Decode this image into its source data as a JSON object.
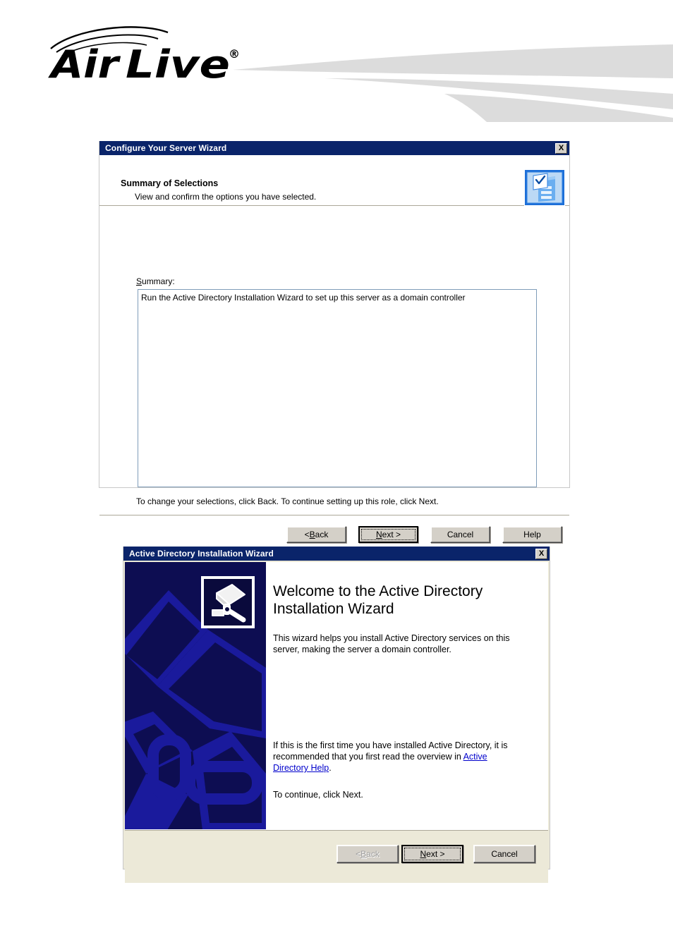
{
  "page": {
    "brand_name": "Air Live",
    "brand_trademark": "®"
  },
  "dialog_configure_server": {
    "title": "Configure Your Server Wizard",
    "close_label": "X",
    "header_title": "Summary of Selections",
    "header_subtitle": "View and confirm the options you have selected.",
    "header_icon": "server-checklist-icon",
    "summary_label": "Summary:",
    "summary_items": [
      "Run the Active Directory Installation Wizard to set up this server as a domain controller"
    ],
    "instruction": "To change your selections, click Back. To continue setting up this role, click Next.",
    "buttons": [
      {
        "label": "< Back",
        "accel": "B",
        "state": "enabled",
        "default": false
      },
      {
        "label": "Next >",
        "accel": "N",
        "state": "enabled",
        "default": true
      },
      {
        "label": "Cancel",
        "accel": "",
        "state": "enabled",
        "default": false
      },
      {
        "label": "Help",
        "accel": "",
        "state": "enabled",
        "default": false
      }
    ]
  },
  "dialog_ad_wizard": {
    "title": "Active Directory Installation Wizard",
    "close_label": "X",
    "banner_icon": "active-directory-icon",
    "heading": "Welcome to the Active Directory Installation Wizard",
    "paragraph_1": "This wizard helps you install Active Directory services on this server, making the server a domain controller.",
    "paragraph_2_before": "If this is the first time you have installed Active Directory, it is recommended that you first read the overview in ",
    "paragraph_2_link": "Active Directory Help",
    "paragraph_2_after": ".",
    "paragraph_3": "To continue, click Next.",
    "buttons": [
      {
        "label": "< Back",
        "accel": "B",
        "state": "disabled",
        "default": false
      },
      {
        "label": "Next >",
        "accel": "N",
        "state": "enabled",
        "default": true
      },
      {
        "label": "Cancel",
        "accel": "",
        "state": "enabled",
        "default": false
      }
    ]
  },
  "colors": {
    "titlebar_blue": "#0a246a",
    "dialog_face": "#ece9d8",
    "button_face": "#d4d0c8",
    "banner_navy": "#0d0d52",
    "link_blue": "#0000cc",
    "swoosh_gray": "#dcdcdc"
  }
}
